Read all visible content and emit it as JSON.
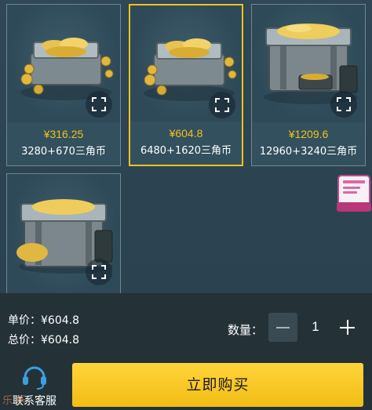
{
  "products": [
    {
      "price": "¥316.25",
      "pack": "3280+670三角币",
      "selected": false
    },
    {
      "price": "¥604.8",
      "pack": "6480+1620三角币",
      "selected": true
    },
    {
      "price": "¥1209.6",
      "pack": "12960+3240三角币",
      "selected": false
    },
    {
      "price": "",
      "pack": "",
      "selected": false
    }
  ],
  "order_float": {
    "label": "我的订单"
  },
  "summary": {
    "unit_price_label": "单价：",
    "unit_price_value": "¥604.8",
    "total_label": "总价：",
    "total_value": "¥604.8"
  },
  "quantity": {
    "label": "数量：",
    "value": "1"
  },
  "service": {
    "label": "联系客服"
  },
  "buy_button": {
    "label": "立即购买"
  },
  "watermark": "乐 乐",
  "colors": {
    "accent": "#f2c21b",
    "background": "#2c4350",
    "bottom_bar": "#243238"
  }
}
